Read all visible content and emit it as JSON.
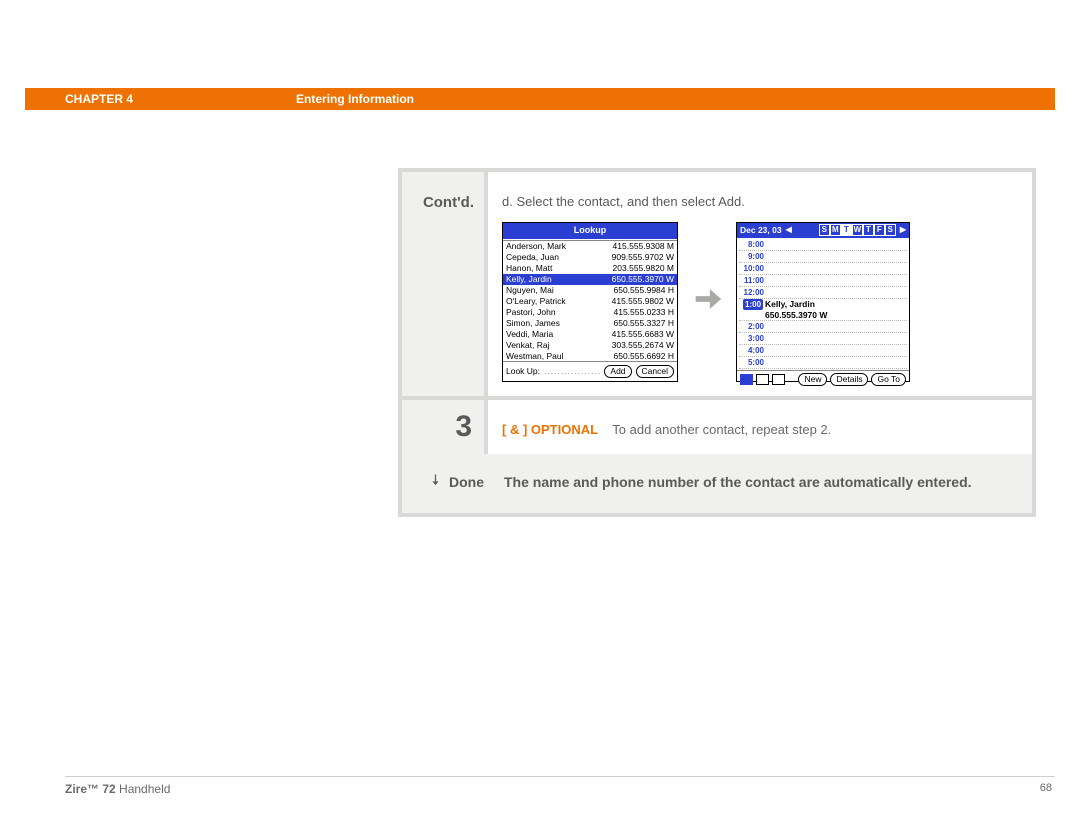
{
  "header": {
    "chapter": "CHAPTER 4",
    "section": "Entering Information"
  },
  "steps": {
    "contd_label": "Cont'd.",
    "instr_d": "d.  Select the contact, and then select Add.",
    "step3_num": "3",
    "optional_tag": "[ & ]  OPTIONAL",
    "optional_text": "To add another contact, repeat step 2.",
    "done_label": "Done",
    "done_text": "The name and phone number of the contact are automatically entered."
  },
  "lookup": {
    "title": "Lookup",
    "rows": [
      {
        "name": "Anderson, Mark",
        "num": "415.555.9308 M"
      },
      {
        "name": "Cepeda, Juan",
        "num": "909.555.9702 W"
      },
      {
        "name": "Hanon, Matt",
        "num": "203.555.9820 M"
      },
      {
        "name": "Kelly, Jardin",
        "num": "650.555.3970 W",
        "sel": true
      },
      {
        "name": "Nguyen, Mai",
        "num": "650.555.9984 H"
      },
      {
        "name": "O'Leary, Patrick",
        "num": "415.555.9802 W"
      },
      {
        "name": "Pastori, John",
        "num": "415.555.0233 H"
      },
      {
        "name": "Simon, James",
        "num": "650.555.3327 H"
      },
      {
        "name": "Veddi, Maria",
        "num": "415.555.6683 W"
      },
      {
        "name": "Venkat, Raj",
        "num": "303.555.2674 W"
      },
      {
        "name": "Westman, Paul",
        "num": "650.555.6692 H"
      }
    ],
    "lookup_label": "Look Up:",
    "add_btn": "Add",
    "cancel_btn": "Cancel"
  },
  "calendar": {
    "date": "Dec 23, 03",
    "days": [
      "S",
      "M",
      "T",
      "W",
      "T",
      "F",
      "S"
    ],
    "current_day_index": 2,
    "times": [
      "8:00",
      "9:00",
      "10:00",
      "11:00",
      "12:00",
      "1:00",
      "2:00",
      "3:00",
      "4:00",
      "5:00"
    ],
    "event_time": "1:00",
    "event_name": "Kelly, Jardin",
    "event_phone": "650.555.3970 W",
    "new_btn": "New",
    "details_btn": "Details",
    "goto_btn": "Go To"
  },
  "footer": {
    "product_bold": "Zire™ 72",
    "product_rest": " Handheld",
    "page": "68"
  }
}
